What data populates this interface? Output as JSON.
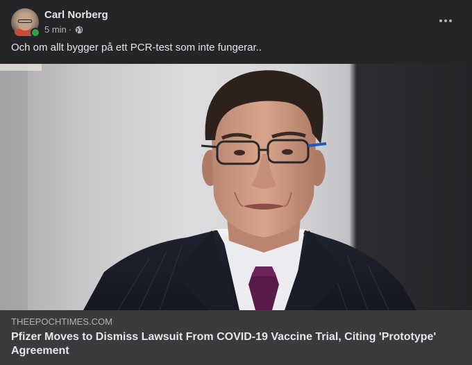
{
  "post": {
    "author": "Carl Norberg",
    "time": "5 min",
    "separator": "·",
    "privacy_icon": "globe-icon",
    "more_icon": "more-options-icon",
    "text": "Och om allt bygger på ett PCR-test som inte fungerar..",
    "online_status_color": "#31a24c"
  },
  "link_preview": {
    "domain": "THEEPOCHTIMES.COM",
    "title": "Pfizer Moves to Dismiss Lawsuit From COVID-19 Vaccine Trial, Citing 'Prototype' Agreement"
  },
  "theme": {
    "card_background": "#242526",
    "link_background": "#3a3b3c",
    "primary_text": "#e4e6eb",
    "secondary_text": "#b0b3b8"
  }
}
